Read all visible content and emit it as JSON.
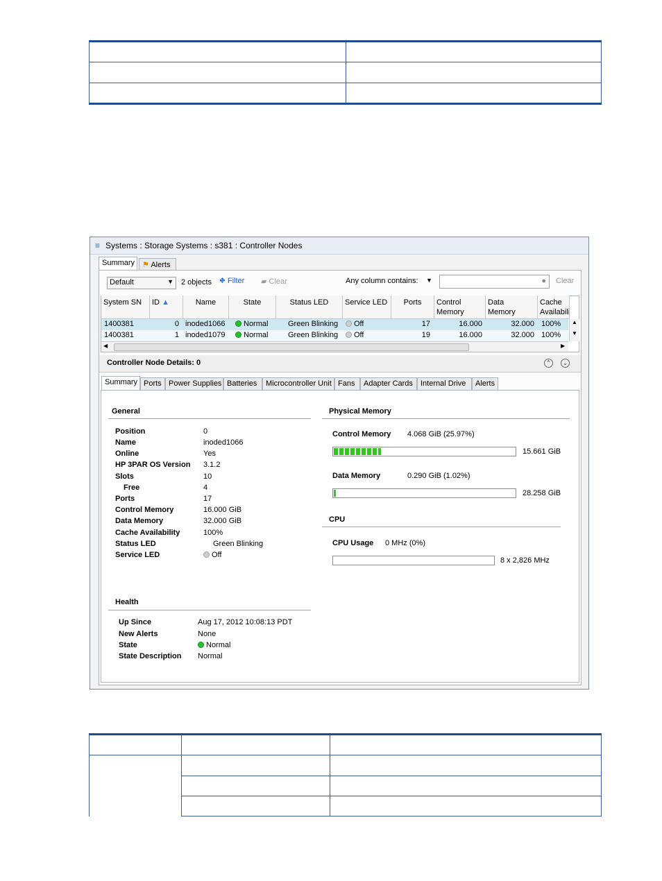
{
  "window": {
    "title": "Systems : Storage Systems : s381 : Controller Nodes",
    "top_tabs": [
      "Summary",
      "Alerts"
    ],
    "active_top_tab": "Summary"
  },
  "toolbar": {
    "view_select": "Default",
    "objects_count": "2 objects",
    "filter_label": "Filter",
    "clear_filter_label": "Clear",
    "search_label": "Any column contains:",
    "search_value": "",
    "search_clear_label": "Clear"
  },
  "grid": {
    "columns": [
      "System SN",
      "ID",
      "Name",
      "State",
      "Status LED",
      "Service LED",
      "Ports",
      "Control Memory (GiB)",
      "Data Memory (GiB)",
      "Cache Availabili"
    ],
    "column_lines": [
      [
        "System SN"
      ],
      [
        "ID"
      ],
      [
        "Name"
      ],
      [
        "State"
      ],
      [
        "Status LED"
      ],
      [
        "Service LED"
      ],
      [
        "Ports"
      ],
      [
        "Control",
        "Memory (GiB)"
      ],
      [
        "Data",
        "Memory (GiB)"
      ],
      [
        "Cache",
        "Availabili"
      ]
    ],
    "rows": [
      {
        "sn": "1400381",
        "id": "0",
        "name": "inoded1066",
        "state": "Normal",
        "status_led": "Green Blinking",
        "service_led": "Off",
        "ports": "17",
        "control_mem": "16.000",
        "data_mem": "32.000",
        "cache": "100%"
      },
      {
        "sn": "1400381",
        "id": "1",
        "name": "inoded1079",
        "state": "Normal",
        "status_led": "Green Blinking",
        "service_led": "Off",
        "ports": "19",
        "control_mem": "16.000",
        "data_mem": "32.000",
        "cache": "100%"
      }
    ]
  },
  "details": {
    "header": "Controller Node Details: 0",
    "tabs": [
      "Summary",
      "Ports",
      "Power Supplies",
      "Batteries",
      "Microcontroller Unit",
      "Fans",
      "Adapter Cards",
      "Internal Drive",
      "Alerts"
    ],
    "general": {
      "title": "General",
      "fields": [
        {
          "label": "Position",
          "value": "0"
        },
        {
          "label": "Name",
          "value": "inoded1066"
        },
        {
          "label": "Online",
          "value": "Yes"
        },
        {
          "label": "HP 3PAR OS Version",
          "value": "3.1.2"
        },
        {
          "label": "Slots",
          "value": "10"
        },
        {
          "label": "Free",
          "value": "4"
        },
        {
          "label": "Ports",
          "value": "17"
        },
        {
          "label": "Control Memory",
          "value": "16.000 GiB"
        },
        {
          "label": "Data Memory",
          "value": "32.000 GiB"
        },
        {
          "label": "Cache Availability",
          "value": "100%"
        },
        {
          "label": "Status LED",
          "value": "Green Blinking"
        },
        {
          "label": "Service LED",
          "value": "Off"
        }
      ]
    },
    "health": {
      "title": "Health",
      "fields": [
        {
          "label": "Up Since",
          "value": "Aug 17, 2012 10:08:13 PDT"
        },
        {
          "label": "New Alerts",
          "value": "None"
        },
        {
          "label": "State",
          "value": "Normal"
        },
        {
          "label": "State Description",
          "value": "Normal"
        }
      ]
    },
    "physical_memory": {
      "title": "Physical Memory",
      "control_label": "Control Memory",
      "control_used": "4.068 GiB (25.97%)",
      "control_fraction": 0.2597,
      "control_total": "15.661 GiB",
      "data_label": "Data Memory",
      "data_used": "0.290 GiB (1.02%)",
      "data_fraction": 0.0102,
      "data_total": "28.258 GiB"
    },
    "cpu": {
      "title": "CPU",
      "usage_label": "CPU Usage",
      "usage_value": "0 MHz (0%)",
      "usage_fraction": 0,
      "total": "8 x 2,826 MHz"
    }
  }
}
